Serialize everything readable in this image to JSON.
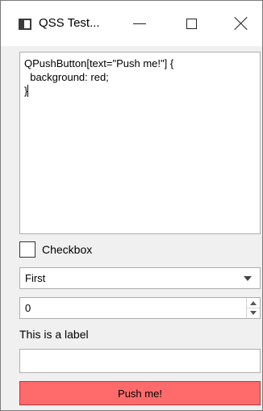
{
  "window": {
    "title": "QSS Test...",
    "icon": "app-window-icon",
    "controls": [
      "minimize-icon",
      "maximize-icon",
      "close-icon"
    ]
  },
  "editor": {
    "lines": [
      "QPushButton[text=\"Push me!\"] {",
      "  background: red;",
      "}"
    ]
  },
  "checkbox": {
    "label": "Checkbox",
    "checked": false
  },
  "combo": {
    "selected": "First"
  },
  "spinbox": {
    "value": "0"
  },
  "label": {
    "text": "This is a label"
  },
  "line_edit": {
    "value": ""
  },
  "push_button": {
    "label": "Push me!",
    "background": "#ff6b6b"
  }
}
